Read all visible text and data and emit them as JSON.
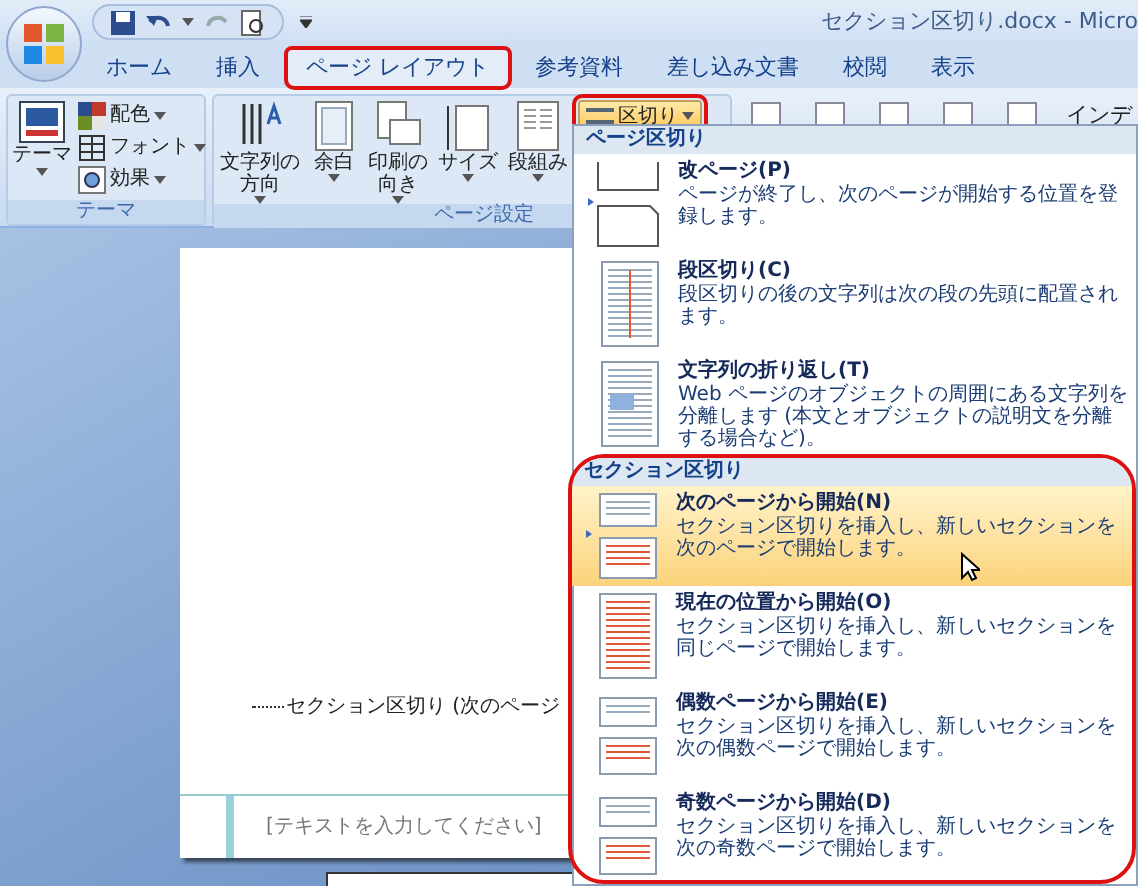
{
  "title_bar": {
    "title": "セクション区切り.docx - Micro"
  },
  "tabs": [
    {
      "label": "ホーム",
      "selected": false,
      "annotated": false
    },
    {
      "label": "挿入",
      "selected": false,
      "annotated": false
    },
    {
      "label": "ページ レイアウト",
      "selected": true,
      "annotated": true
    },
    {
      "label": "参考資料",
      "selected": false,
      "annotated": false
    },
    {
      "label": "差し込み文書",
      "selected": false,
      "annotated": false
    },
    {
      "label": "校閲",
      "selected": false,
      "annotated": false
    },
    {
      "label": "表示",
      "selected": false,
      "annotated": false
    }
  ],
  "ribbon": {
    "theme_group": {
      "label": "テーマ",
      "button": "テーマ",
      "items": [
        {
          "label": "配色",
          "kind": "colors"
        },
        {
          "label": "フォント",
          "kind": "fonts"
        },
        {
          "label": "効果",
          "kind": "effects"
        }
      ]
    },
    "page_setup_group": {
      "label": "ページ設定",
      "buttons": [
        {
          "lines": [
            "文字列の",
            "方向"
          ],
          "kind": "direction"
        },
        {
          "lines": [
            "余白"
          ],
          "kind": "margins"
        },
        {
          "lines": [
            "印刷の",
            "向き"
          ],
          "kind": "orientation"
        },
        {
          "lines": [
            "サイズ"
          ],
          "kind": "size"
        },
        {
          "lines": [
            "段組み"
          ],
          "kind": "columns"
        }
      ],
      "breaks_button": {
        "label": "区切り",
        "annotated": true
      }
    },
    "right_text": "インデ"
  },
  "menu": {
    "sections": [
      {
        "header": "ページ区切り",
        "annotated": false,
        "items": [
          {
            "kind": "page",
            "title": "改ページ(P)",
            "description": "ページが終了し、次のページが開始する位置を登録します。",
            "hovered": false
          },
          {
            "kind": "column",
            "title": "段区切り(C)",
            "description": "段区切りの後の文字列は次の段の先頭に配置されます。",
            "hovered": false
          },
          {
            "kind": "wrap",
            "title": "文字列の折り返し(T)",
            "description": "Web ページのオブジェクトの周囲にある文字列を分離します (本文とオブジェクトの説明文を分離する場合など)。",
            "hovered": false
          }
        ]
      },
      {
        "header": "セクション区切り",
        "annotated": true,
        "items": [
          {
            "kind": "next",
            "title": "次のページから開始(N)",
            "description": "セクション区切りを挿入し、新しいセクションを次のページで開始します。",
            "hovered": true
          },
          {
            "kind": "continuous",
            "title": "現在の位置から開始(O)",
            "description": "セクション区切りを挿入し、新しいセクションを同じページで開始します。",
            "hovered": false
          },
          {
            "kind": "even",
            "title": "偶数ページから開始(E)",
            "description": "セクション区切りを挿入し、新しいセクションを次の偶数ページで開始します。",
            "hovered": false
          },
          {
            "kind": "odd",
            "title": "奇数ページから開始(D)",
            "description": "セクション区切りを挿入し、新しいセクションを次の奇数ページで開始します。",
            "hovered": false
          }
        ]
      }
    ]
  },
  "document": {
    "section_break": "セクション区切り (次のページ",
    "footer_placeholder": "[テキストを入力してください]"
  }
}
